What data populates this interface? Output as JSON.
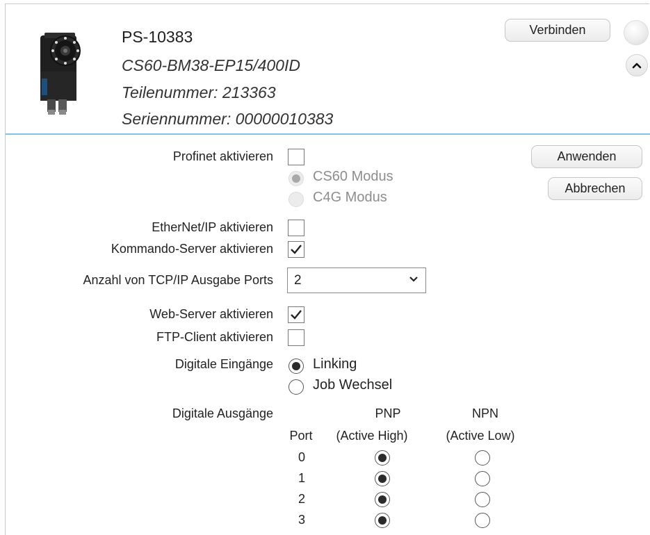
{
  "device": {
    "title": "PS-10383",
    "model": "CS60-BM38-EP15/400ID",
    "part_number": "Teilenummer: 213363",
    "serial_number": "Seriennummer: 00000010383"
  },
  "buttons": {
    "connect": "Verbinden",
    "apply": "Anwenden",
    "cancel": "Abbrechen"
  },
  "form": {
    "profinet": {
      "label": "Profinet aktivieren",
      "checked": false
    },
    "profinet_modes": {
      "cs60": "CS60 Modus",
      "c4g": "C4G Modus",
      "selected": "cs60",
      "enabled": false
    },
    "ethernet_ip": {
      "label": "EtherNet/IP aktivieren",
      "checked": false
    },
    "command_server": {
      "label": "Kommando-Server aktivieren",
      "checked": true
    },
    "tcp_ports": {
      "label": "Anzahl von TCP/IP Ausgabe Ports",
      "value": "2"
    },
    "web_server": {
      "label": "Web-Server aktivieren",
      "checked": true
    },
    "ftp_client": {
      "label": "FTP-Client aktivieren",
      "checked": false
    },
    "digital_inputs": {
      "label": "Digitale Eingänge",
      "linking": "Linking",
      "job_change": "Job Wechsel",
      "selected": "linking"
    },
    "digital_outputs": {
      "label": "Digitale Ausgänge",
      "col_port": "Port",
      "col_pnp_1": "PNP",
      "col_pnp_2": "(Active High)",
      "col_npn_1": "NPN",
      "col_npn_2": "(Active Low)",
      "ports": [
        {
          "port": "0",
          "mode": "PNP"
        },
        {
          "port": "1",
          "mode": "PNP"
        },
        {
          "port": "2",
          "mode": "PNP"
        },
        {
          "port": "3",
          "mode": "PNP"
        }
      ]
    }
  },
  "colors": {
    "divider": "#7ec3e4",
    "radio_selected": "#2b2b2b"
  }
}
